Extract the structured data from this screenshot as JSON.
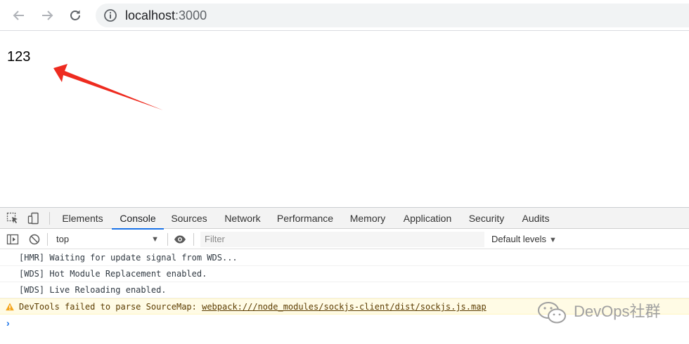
{
  "browser": {
    "back_icon": "arrow-left-icon",
    "forward_icon": "arrow-right-icon",
    "reload_icon": "reload-icon",
    "url_host": "localhost",
    "url_port": ":3000"
  },
  "page": {
    "text": "123",
    "annotation_color": "#ee2b1f"
  },
  "devtools": {
    "tabs": [
      "Elements",
      "Console",
      "Sources",
      "Network",
      "Performance",
      "Memory",
      "Application",
      "Security",
      "Audits"
    ],
    "active_tab": "Console",
    "context": "top",
    "filter_placeholder": "Filter",
    "levels": "Default levels",
    "messages": [
      "[HMR] Waiting for update signal from WDS...",
      "[WDS] Hot Module Replacement enabled.",
      "[WDS] Live Reloading enabled."
    ],
    "warning": {
      "prefix": "DevTools failed to parse SourceMap: ",
      "link": "webpack:///node_modules/sockjs-client/dist/sockjs.js.map"
    },
    "prompt": "›"
  },
  "watermark": {
    "text": "DevOps社群"
  },
  "colors": {
    "accent": "#1a73e8",
    "warning_bg": "#fffbe5",
    "annotation": "#ee2b1f"
  }
}
